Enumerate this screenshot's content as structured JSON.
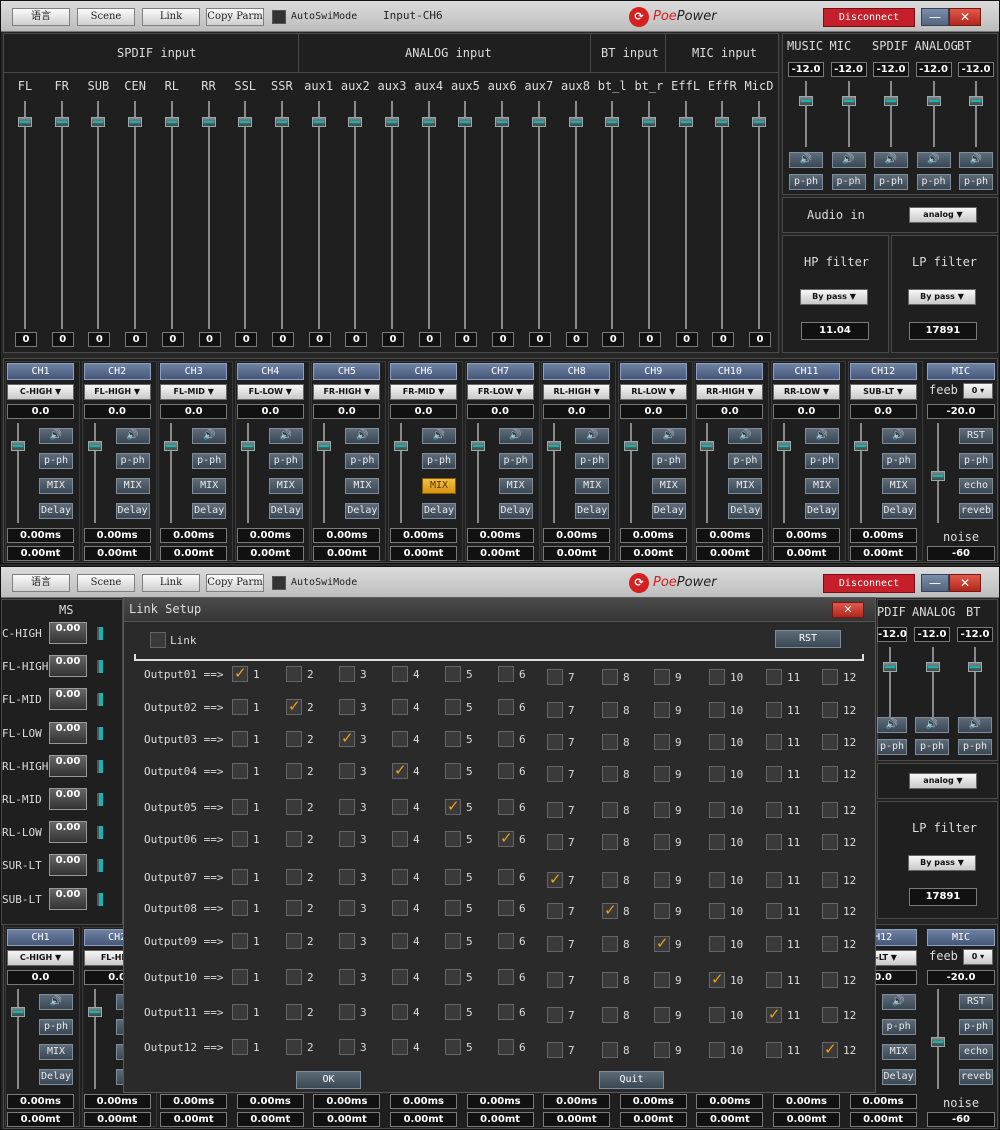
{
  "toolbar": {
    "lang": "语言",
    "scene": "Scene",
    "link": "Link",
    "copy": "Copy Parm",
    "autoswi": "AutoSwiMode",
    "title1": "Input-CH6",
    "brand_a": "Poe",
    "brand_b": "Power",
    "disconnect": "Disconnect",
    "minimize": "—",
    "close": "✕"
  },
  "input": {
    "sections": {
      "spdif": "SPDIF input",
      "analog": "ANALOG input",
      "bt": "BT input",
      "mic": "MIC input"
    },
    "channels": [
      {
        "label": "FL",
        "value": "0"
      },
      {
        "label": "FR",
        "value": "0"
      },
      {
        "label": "SUB",
        "value": "0"
      },
      {
        "label": "CEN",
        "value": "0"
      },
      {
        "label": "RL",
        "value": "0"
      },
      {
        "label": "RR",
        "value": "0"
      },
      {
        "label": "SSL",
        "value": "0"
      },
      {
        "label": "SSR",
        "value": "0"
      },
      {
        "label": "aux1",
        "value": "0"
      },
      {
        "label": "aux2",
        "value": "0"
      },
      {
        "label": "aux3",
        "value": "0"
      },
      {
        "label": "aux4",
        "value": "0"
      },
      {
        "label": "aux5",
        "value": "0"
      },
      {
        "label": "aux6",
        "value": "0"
      },
      {
        "label": "aux7",
        "value": "0"
      },
      {
        "label": "aux8",
        "value": "0"
      },
      {
        "label": "bt_l",
        "value": "0"
      },
      {
        "label": "bt_r",
        "value": "0"
      },
      {
        "label": "EffL",
        "value": "0"
      },
      {
        "label": "EffR",
        "value": "0"
      },
      {
        "label": "MicD",
        "value": "0"
      }
    ]
  },
  "mixer": {
    "channels": [
      {
        "label": "MUSIC",
        "value": "-12.0",
        "mute": "🔊",
        "pph": "p-ph"
      },
      {
        "label": "MIC",
        "value": "-12.0",
        "mute": "🔊",
        "pph": "p-ph"
      },
      {
        "label": "SPDIF",
        "value": "-12.0",
        "mute": "🔊",
        "pph": "p-ph"
      },
      {
        "label": "ANALOG",
        "value": "-12.0",
        "mute": "🔊",
        "pph": "p-ph"
      },
      {
        "label": "BT",
        "value": "-12.0",
        "mute": "🔊",
        "pph": "p-ph"
      }
    ],
    "audio_in_label": "Audio in",
    "audio_in_value": "analog",
    "hp_label": "HP filter",
    "hp_mode": "By pass",
    "hp_value": "11.04",
    "lp_label": "LP filter",
    "lp_mode": "By pass",
    "lp_value": "17891"
  },
  "outputs": {
    "channels": [
      {
        "name": "CH1",
        "mode": "C-HIGH",
        "gain": "0.0",
        "mute": "🔊",
        "pph": "p-ph",
        "mix": "MIX",
        "delay": "Delay",
        "ms": "0.00ms",
        "mt": "0.00mt"
      },
      {
        "name": "CH2",
        "mode": "FL-HIGH",
        "gain": "0.0",
        "mute": "🔊",
        "pph": "p-ph",
        "mix": "MIX",
        "delay": "Delay",
        "ms": "0.00ms",
        "mt": "0.00mt"
      },
      {
        "name": "CH3",
        "mode": "FL-MID",
        "gain": "0.0",
        "mute": "🔊",
        "pph": "p-ph",
        "mix": "MIX",
        "delay": "Delay",
        "ms": "0.00ms",
        "mt": "0.00mt"
      },
      {
        "name": "CH4",
        "mode": "FL-LOW",
        "gain": "0.0",
        "mute": "🔊",
        "pph": "p-ph",
        "mix": "MIX",
        "delay": "Delay",
        "ms": "0.00ms",
        "mt": "0.00mt"
      },
      {
        "name": "CH5",
        "mode": "FR-HIGH",
        "gain": "0.0",
        "mute": "🔊",
        "pph": "p-ph",
        "mix": "MIX",
        "delay": "Delay",
        "ms": "0.00ms",
        "mt": "0.00mt"
      },
      {
        "name": "CH6",
        "mode": "FR-MID",
        "gain": "0.0",
        "mute": "🔊",
        "pph": "p-ph",
        "mix": "MIX",
        "delay": "Delay",
        "ms": "0.00ms",
        "mt": "0.00mt"
      },
      {
        "name": "CH7",
        "mode": "FR-LOW",
        "gain": "0.0",
        "mute": "🔊",
        "pph": "p-ph",
        "mix": "MIX",
        "delay": "Delay",
        "ms": "0.00ms",
        "mt": "0.00mt"
      },
      {
        "name": "CH8",
        "mode": "RL-HIGH",
        "gain": "0.0",
        "mute": "🔊",
        "pph": "p-ph",
        "mix": "MIX",
        "delay": "Delay",
        "ms": "0.00ms",
        "mt": "0.00mt"
      },
      {
        "name": "CH9",
        "mode": "RL-LOW",
        "gain": "0.0",
        "mute": "🔊",
        "pph": "p-ph",
        "mix": "MIX",
        "delay": "Delay",
        "ms": "0.00ms",
        "mt": "0.00mt"
      },
      {
        "name": "CH10",
        "mode": "RR-HIGH",
        "gain": "0.0",
        "mute": "🔊",
        "pph": "p-ph",
        "mix": "MIX",
        "delay": "Delay",
        "ms": "0.00ms",
        "mt": "0.00mt"
      },
      {
        "name": "CH11",
        "mode": "RR-LOW",
        "gain": "0.0",
        "mute": "🔊",
        "pph": "p-ph",
        "mix": "MIX",
        "delay": "Delay",
        "ms": "0.00ms",
        "mt": "0.00mt"
      },
      {
        "name": "CH12",
        "mode": "SUB-LT",
        "gain": "0.0",
        "mute": "🔊",
        "pph": "p-ph",
        "mix": "MIX",
        "delay": "Delay",
        "ms": "0.00ms",
        "mt": "0.00mt"
      }
    ],
    "active_mix_index": 5,
    "mic": {
      "name": "MIC",
      "feeb": "feeb",
      "feeb_value": "0",
      "value": "-20.0",
      "rst": "RST",
      "pph": "p-ph",
      "echo": "echo",
      "reveb": "reveb",
      "noise": "noise",
      "noise_value": "-60"
    }
  },
  "ms_panel": {
    "title": "MS",
    "rows": [
      {
        "label": "C-HIGH",
        "value": "0.00"
      },
      {
        "label": "FL-HIGH",
        "value": "0.00"
      },
      {
        "label": "FL-MID",
        "value": "0.00"
      },
      {
        "label": "FL-LOW",
        "value": "0.00"
      },
      {
        "label": "RL-HIGH",
        "value": "0.00"
      },
      {
        "label": "RL-MID",
        "value": "0.00"
      },
      {
        "label": "RL-LOW",
        "value": "0.00"
      },
      {
        "label": "SUR-LT",
        "value": "0.00"
      },
      {
        "label": "SUB-LT",
        "value": "0.00"
      }
    ]
  },
  "window2": {
    "bg_ch_left": [
      "CH1",
      "CH2"
    ],
    "bg_ch_right": "H12",
    "bg_mode_left": [
      "C-HIGH",
      "FL-HI"
    ],
    "bg_mode_right": "B-LT",
    "bg_gain_left": [
      "0.0",
      "0.0"
    ],
    "bg_gain_right": "0.0",
    "bg_mute": "🔊",
    "bg_pph": "p-ph",
    "bg_mix": "MIX",
    "bg_delay": "Delay",
    "bg_delay_short": "D",
    "bg_pph_short": "p",
    "bg_spdif": "PDIF",
    "bg_analog": "ANALOG",
    "bg_bt": "BT",
    "bg_v1": "-12.0",
    "bg_v2": "-12.0",
    "bg_v3": "-12.0",
    "bg_audio": "analog",
    "bg_lp": "LP filter",
    "bg_lp_mode": "By pass",
    "bg_lp_value": "17891"
  },
  "link_dialog": {
    "title": "Link Setup",
    "close": "✕",
    "link_label": "Link",
    "rst": "RST",
    "ok": "OK",
    "quit": "Quit",
    "columns": [
      "1",
      "2",
      "3",
      "4",
      "5",
      "6",
      "7",
      "8",
      "9",
      "10",
      "11",
      "12"
    ],
    "rows": [
      {
        "label": "Output01 ==>",
        "checked": 1
      },
      {
        "label": "Output02 ==>",
        "checked": 2
      },
      {
        "label": "Output03 ==>",
        "checked": 3
      },
      {
        "label": "Output04 ==>",
        "checked": 4
      },
      {
        "label": "Output05 ==>",
        "checked": 5
      },
      {
        "label": "Output06 ==>",
        "checked": 6
      },
      {
        "label": "Output07 ==>",
        "checked": 7
      },
      {
        "label": "Output08 ==>",
        "checked": 8
      },
      {
        "label": "Output09 ==>",
        "checked": 9
      },
      {
        "label": "Output10 ==>",
        "checked": 10
      },
      {
        "label": "Output11 ==>",
        "checked": 11
      },
      {
        "label": "Output12 ==>",
        "checked": 12
      }
    ]
  },
  "colors": {
    "accent": "#17b3b3",
    "active": "#e8a820",
    "danger": "#c41f2b",
    "panel": "#1f1f1f"
  }
}
